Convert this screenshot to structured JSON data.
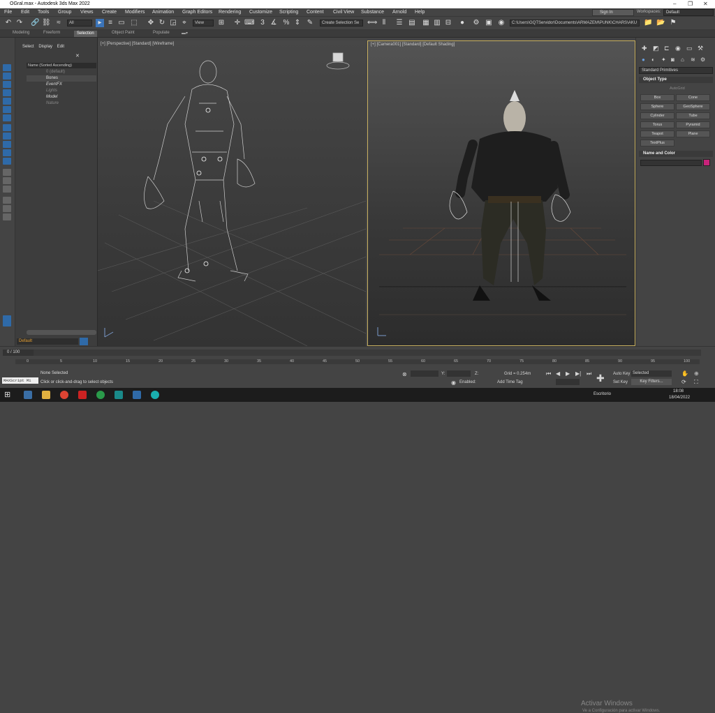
{
  "title_bar": {
    "title": "OGral.max - Autodesk 3ds Max 2022"
  },
  "menu": [
    "File",
    "Edit",
    "Tools",
    "Group",
    "Views",
    "Create",
    "Modifiers",
    "Animation",
    "Graph Editors",
    "Rendering",
    "Customize",
    "Scripting",
    "Content",
    "Civil View",
    "Substance",
    "Arnold",
    "Help"
  ],
  "signin": "Sign In",
  "workspace": {
    "label": "Workspaces:",
    "value": "Default"
  },
  "toolbar": {
    "filter": "All",
    "view": "View",
    "selection_set": "Create Selection Se",
    "path": "C:\\Users\\GQTServidor\\Documents\\ARMAZEM\\PUNK\\CHARS\\AKU"
  },
  "ribbon": [
    "Modeling",
    "Freeform",
    "Selection",
    "Object Paint",
    "Populate"
  ],
  "ribbon_active": "Selection",
  "scene": {
    "menu": [
      "Select",
      "Display",
      "Edit"
    ],
    "header": "Name (Sorted Ascending)",
    "rows": [
      "0 (default)",
      "Bones",
      "EventFX",
      "Lights",
      "Model",
      "Nature"
    ]
  },
  "viewports": {
    "left": "[+] [Perspective] [Standard] [Wireframe]",
    "right": "[+] [Camera001] [Standard] [Default Shading]"
  },
  "command_panel": {
    "category": "Standard Primitives",
    "rollout_object": "Object Type",
    "autogrid": "AutoGrid",
    "buttons": [
      "Box",
      "Cone",
      "Sphere",
      "GeoSphere",
      "Cylinder",
      "Tube",
      "Torus",
      "Pyramid",
      "Teapot",
      "Plane",
      "TextPlus"
    ],
    "rollout_name": "Name and Color",
    "swatch_color": "#c8237a"
  },
  "bottom": {
    "layer": "Default",
    "frame": "0 / 100",
    "ticks": [
      "0",
      "5",
      "10",
      "15",
      "20",
      "25",
      "30",
      "35",
      "40",
      "45",
      "50",
      "55",
      "60",
      "65",
      "70",
      "75",
      "80",
      "85",
      "90",
      "95",
      "100"
    ],
    "status": "None Selected",
    "prompt": "Click or click-and-drag to select objects",
    "maxscript": "MAXScript Mi",
    "grid": "Grid = 0.254m",
    "y_label": "Y:",
    "z_label": "Z:",
    "enabled": "Enabled:",
    "add_time_tag": "Add Time Tag",
    "auto_key": "Auto Key",
    "selected": "Selected",
    "set_key": "Set Key",
    "key_filters": "Key Filters..."
  },
  "watermark": {
    "line1": "Activar Windows",
    "line2": "Ve a Configuración para activar Windows."
  },
  "taskbar": {
    "desktop": "Escritorio",
    "time": "18:08",
    "date": "18/04/2022"
  }
}
